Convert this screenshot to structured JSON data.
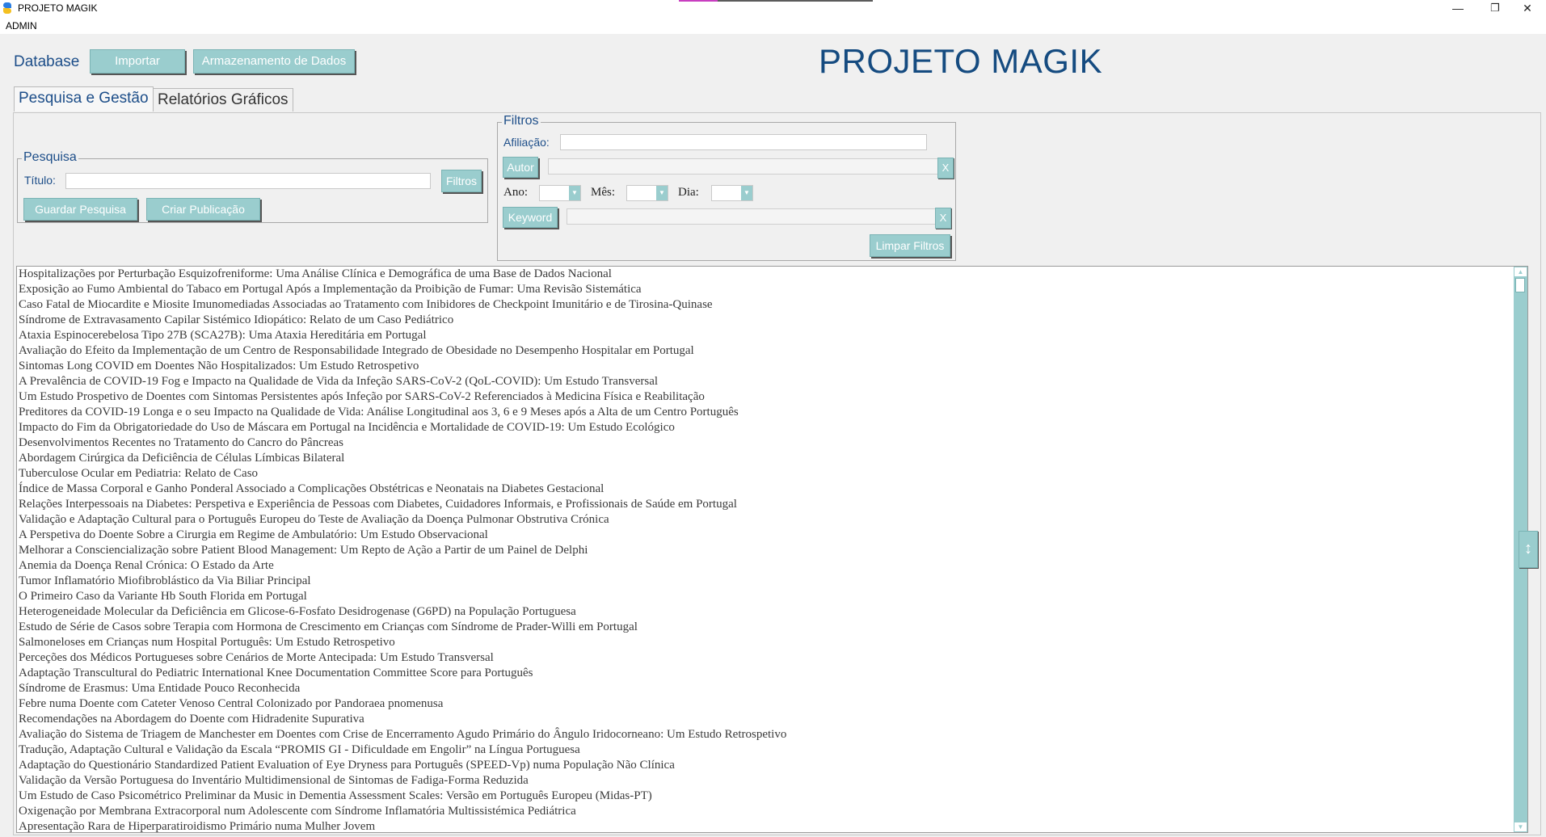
{
  "window": {
    "title": "PROJETO MAGIK",
    "minimize_glyph": "—",
    "restore_glyph": "❐",
    "close_glyph": "✕",
    "app_icon": "python-icon"
  },
  "menu": {
    "user": "ADMIN"
  },
  "toolbar": {
    "database_label": "Database",
    "import_button": "Importar",
    "storage_button": "Armazenamento de Dados"
  },
  "header": {
    "title": "PROJETO MAGIK"
  },
  "tabs": [
    {
      "label": "Pesquisa e Gestão",
      "active": true
    },
    {
      "label": "Relatórios Gráficos",
      "active": false
    }
  ],
  "search": {
    "legend": "Pesquisa",
    "title_label": "Título:",
    "title_value": "",
    "filters_button": "Filtros",
    "save_button": "Guardar Pesquisa",
    "create_button": "Criar Publicação"
  },
  "filters": {
    "legend": "Filtros",
    "affiliation_label": "Afiliação:",
    "affiliation_value": "",
    "author_button": "Autor",
    "author_value": "",
    "author_clear": "X",
    "year_label": "Ano:",
    "year_value": "",
    "month_label": "Mês:",
    "month_value": "",
    "day_label": "Dia:",
    "day_value": "",
    "keyword_button": "Keyword",
    "keyword_value": "",
    "keyword_clear": "X",
    "clear_button": "Limpar Filtros"
  },
  "results": [
    "Hospitalizações por Perturbação Esquizofreniforme: Uma Análise Clínica e Demográfica de uma Base de Dados Nacional",
    "Exposição ao Fumo Ambiental do Tabaco em Portugal Após a Implementação da Proibição de Fumar: Uma Revisão Sistemática",
    "Caso Fatal de Miocardite e Miosite Imunomediadas Associadas ao Tratamento com Inibidores de Checkpoint Imunitário e de Tirosina-Quinase",
    "Síndrome de Extravasamento Capilar Sistémico Idiopático: Relato de um Caso Pediátrico",
    "Ataxia Espinocerebelosa Tipo 27B (SCA27B): Uma Ataxia Hereditária em Portugal",
    "Avaliação do Efeito da Implementação de um Centro de Responsabilidade Integrado de Obesidade no Desempenho Hospitalar em Portugal",
    "Sintomas Long COVID em Doentes Não Hospitalizados: Um Estudo Retrospetivo",
    "A Prevalência de COVID-19 Fog e Impacto na Qualidade de Vida da Infeção SARS-CoV-2 (QoL-COVID): Um Estudo Transversal",
    "Um Estudo Prospetivo de Doentes com Sintomas Persistentes após Infeção por SARS-CoV-2 Referenciados à Medicina Física e Reabilitação",
    "Preditores da COVID-19 Longa e o seu Impacto na Qualidade de Vida: Análise Longitudinal aos 3, 6 e 9 Meses após a Alta de um Centro Português",
    "Impacto do Fim da Obrigatoriedade do Uso de Máscara em Portugal na Incidência e Mortalidade de COVID-19: Um Estudo Ecológico",
    "Desenvolvimentos Recentes no Tratamento do Cancro do Pâncreas",
    "Abordagem Cirúrgica da Deficiência de Células Límbicas Bilateral",
    "Tuberculose Ocular em Pediatria: Relato de Caso",
    "Índice de Massa Corporal e Ganho Ponderal Associado a Complicações Obstétricas e Neonatais na Diabetes Gestacional",
    "Relações Interpessoais na Diabetes: Perspetiva e Experiência de Pessoas com Diabetes, Cuidadores Informais, e Profissionais de Saúde em Portugal",
    "Validação e Adaptação Cultural para o Português Europeu do Teste de Avaliação da Doença Pulmonar Obstrutiva Crónica",
    "A Perspetiva do Doente Sobre a Cirurgia em Regime de Ambulatório: Um Estudo Observacional",
    "Melhorar a Consciencialização sobre Patient Blood Management: Um Repto de Ação a Partir de um Painel de Delphi",
    "Anemia da Doença Renal Crónica: O Estado da Arte",
    "Tumor Inflamatório Miofibroblástico da Via Biliar Principal",
    "O Primeiro Caso da Variante Hb South Florida em Portugal",
    "Heterogeneidade Molecular da Deficiência em Glicose-6-Fosfato Desidrogenase (G6PD) na População Portuguesa",
    "Estudo de Série de Casos sobre Terapia com Hormona de Crescimento em Crianças com Síndrome de Prader-Willi em Portugal",
    "Salmoneloses em Crianças num Hospital Português: Um Estudo Retrospetivo",
    "Perceções dos Médicos Portugueses sobre Cenários de Morte Antecipada: Um Estudo Transversal",
    "Adaptação Transcultural do Pediatric International Knee Documentation Committee Score para Português",
    "Síndrome de Erasmus: Uma Entidade Pouco Reconhecida",
    "Febre numa Doente com Cateter Venoso Central Colonizado por Pandoraea pnomenusa",
    "Recomendações na Abordagem do Doente com Hidradenite Supurativa",
    "Avaliação do Sistema de Triagem de Manchester em Doentes com Crise de Encerramento Agudo Primário do Ângulo Iridocorneano: Um Estudo Retrospetivo",
    "Tradução, Adaptação Cultural e Validação da Escala “PROMIS GI - Dificuldade em Engolir” na Língua Portuguesa",
    "Adaptação do Questionário Standardized Patient Evaluation of Eye Dryness para Português (SPEED-Vp) numa População Não Clínica",
    "Validação da Versão Portuguesa do Inventário Multidimensional de Sintomas de Fadiga-Forma Reduzida",
    "Um Estudo de Caso Psicométrico Preliminar da Music in Dementia Assessment Scales: Versão em Português Europeu (Midas-PT)",
    "Oxigenação por Membrana Extracorporal num Adolescente com Síndrome Inflamatória Multissistémica Pediátrica",
    "Apresentação Rara de Hiperparatiroidismo Primário numa Mulher Jovem"
  ],
  "scroll": {
    "up_glyph": "▲",
    "down_glyph": "▼",
    "handle_glyph": "↕"
  },
  "colors": {
    "accent": "#9acdce",
    "title": "#154b80",
    "label": "#1d4e89"
  }
}
